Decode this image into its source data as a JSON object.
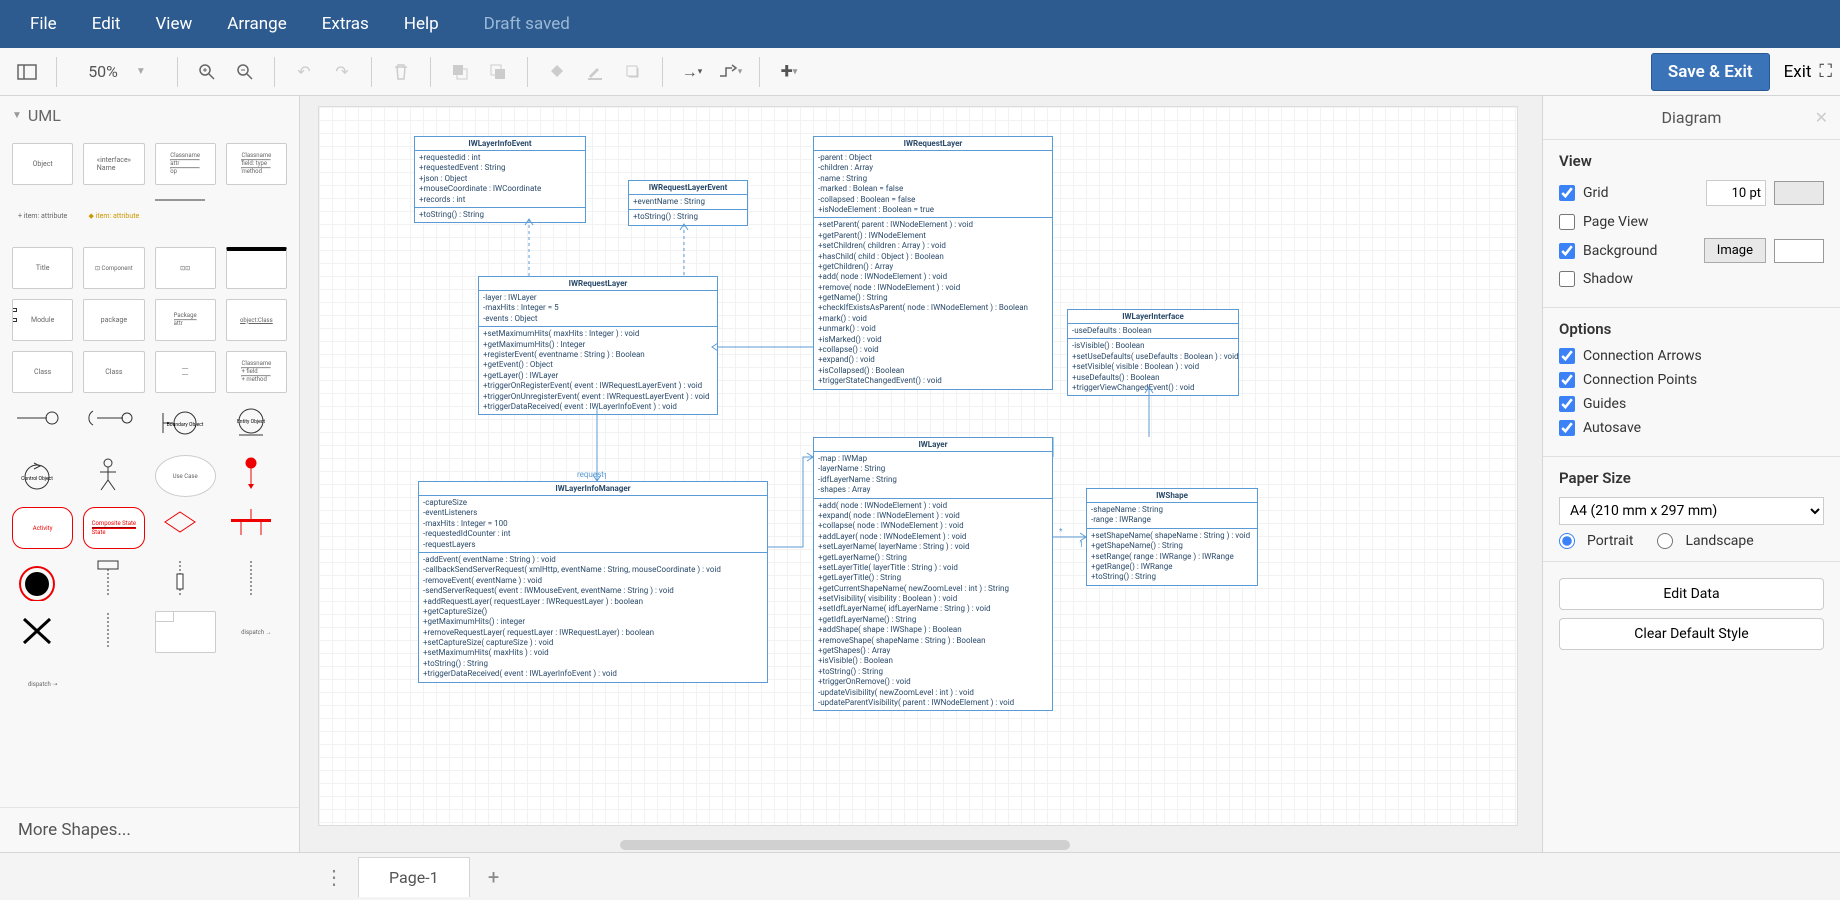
{
  "menu": {
    "file": "File",
    "edit": "Edit",
    "view": "View",
    "arrange": "Arrange",
    "extras": "Extras",
    "help": "Help",
    "saved": "Draft saved"
  },
  "toolbar": {
    "zoom": "50%",
    "save_exit": "Save & Exit",
    "exit": "Exit"
  },
  "palette": {
    "title": "UML",
    "more": "More Shapes..."
  },
  "tabs": {
    "page1": "Page-1"
  },
  "format": {
    "title": "Diagram",
    "view_h": "View",
    "grid": "Grid",
    "grid_val": "10 pt",
    "pageview": "Page View",
    "background": "Background",
    "image_btn": "Image",
    "shadow": "Shadow",
    "options_h": "Options",
    "conn_arrows": "Connection Arrows",
    "conn_points": "Connection Points",
    "guides": "Guides",
    "autosave": "Autosave",
    "paper_h": "Paper Size",
    "paper_sel": "A4 (210 mm x 297 mm)",
    "portrait": "Portrait",
    "landscape": "Landscape",
    "edit_data": "Edit Data",
    "clear_style": "Clear Default Style"
  },
  "uml_classes": {
    "IWLayerInfoEvent": {
      "attrs": "+requestedid : int\n+requestedEvent : String\n+json : Object\n+mouseCoordinate : IWCoordinate\n+records : int",
      "ops": "+toString() : String"
    },
    "IWRequestLayerEvent": {
      "attrs": "+eventName : String",
      "ops": "+toString() : String"
    },
    "IWRequestLayer_top": {
      "attrs": "-parent : Object\n-children : Array\n-name : String\n-marked : Bolean = false\n-collapsed : Boolean = false\n+isNodeElement : Boolean = true",
      "ops": "+setParent( parent : IWNodeElement ) : void\n+getParent() : IWNodeElement\n+setChildren( children : Array ) : void\n+hasChild( child : Object ) : Boolean\n+getChildren() : Array\n+add( node : IWNodeElement ) : void\n+remove( node : IWNodeElement ) : void\n+getName() : String\n+checkIfExistsAsParent( node : IWNodeElement ) : Boolean\n+mark() : void\n+unmark() : void\n+isMarked() : void\n+collapse() : void\n+expand() : void\n+isCollapsed() : Boolean\n+triggerStateChangedEvent() : void"
    },
    "IWRequestLayer_mid": {
      "attrs": "-layer : IWLayer\n-maxHits : Integer = 5\n-events : Object",
      "ops": "+setMaximumHits( maxHits : Integer ) : void\n+getMaximumHits() : Integer\n+registerEvent( eventname : String ) : Boolean\n+getEvent() : Object\n+getLayer() : IWLayer\n+triggerOnRegisterEvent( event : IWRequestLayerEvent ) : void\n+triggerOnUnregisterEvent( event : IWRequestLayerEvent ) : void\n+triggerDataReceived( event : IWLayerInfoEvent ) : void"
    },
    "IWLayerInterface": {
      "attrs": "-useDefaults : Boolean",
      "ops": "-isVisible() : Boolean\n+setUseDefaults( useDefaults : Boolean ) : void\n+setVisible( visible : Boolean ) : void\n+useDefaults() : Boolean\n+triggerViewChangedEvent() : void"
    },
    "IWLayerInfoManager": {
      "attrs": "-captureSize\n-eventListeners\n-maxHits : Integer = 100\n-requestedIdCounter : int\n-requestLayers",
      "ops": "-addEvent( eventName : String ) : void\n-callbackSendServerRequest( xmlHttp, eventName : String, mouseCoordinate ) : void\n-removeEvent( eventName ) : void\n-sendServerRequest( event : IWMouseEvent, eventName : String ) : void\n+addRequestLayer( requestLayer : IWRequestLayer ) : boolean\n+getCaptureSize()\n+getMaximumHits() : integer\n+removeRequestLayer( requestLayer : IWRequestLayer) : boolean\n+setCaptureSize( captureSize ) : void\n+setMaximumHits( maxHits ) : void\n+toString() : String\n+triggerDataReceived( event : IWLayerInfoEvent ) : void"
    },
    "IWLayer": {
      "attrs": "-map : IWMap\n-layerName : String\n-idfLayerName : String\n-shapes : Array",
      "ops": "+add( node : IWNodeElement ) : void\n+expand( node : IWNodeElement ) : void\n+collapse( node : IWNodeElement ) : void\n+addLayer( node : IWNodeElement ) : void\n+setLayerName( layerName : String ) : void\n+getLayerName() : String\n+setLayerTitle( layerTitle : String ) : void\n+getLayerTitle() : String\n+getCurrentShapeName( newZoomLevel : int ) : String\n+setVisibility( visibility : Boolean ) : void\n+setIdfLayerName( idfLayerName : String ) : void\n+getIdfLayerName() : String\n+addShape( shape : IWShape ) : Boolean\n+removeShape( shapeName : String ) : Boolean\n+getShapes() : Array\n+isVisible() : Boolean\n+toString() : String\n+triggerOnRemove() : void\n-updateVisibility( newZoomLevel : int ) : void\n-updateParentVisibility( parent : IWNodeElement ) : void"
    },
    "IWShape": {
      "attrs": "-shapeName : String\n-range : IWRange",
      "ops": "+setShapeName( shapeName : String ) : void\n+getShapeName() : String\n+setRange( range : IWRange ) : IWRange\n+getRange() : IWRange\n+toString() : String"
    }
  }
}
